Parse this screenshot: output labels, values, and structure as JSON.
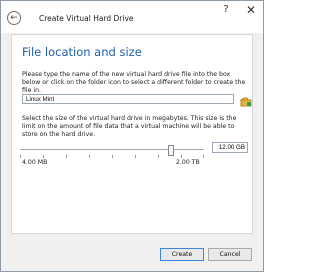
{
  "window": {
    "title": "Create Virtual Hard Drive",
    "help_label": "?",
    "close_label": "✕",
    "back_label": "←"
  },
  "section": {
    "heading": "File location and size",
    "description_location": "Please type the name of the new virtual hard drive file into the box below or click on the folder icon to select a different folder to create the file in.",
    "file_name": "Linux Mint",
    "description_size": "Select the size of the virtual hard drive in megabytes. This size is the limit on the amount of file data that a virtual machine will be able to store on the hard drive.",
    "size_value": "12.00 GB",
    "min_label": "4.00 MB",
    "max_label": "2.00 TB",
    "slider_level_fraction": 0.8
  },
  "buttons": {
    "create": "Create",
    "cancel": "Cancel"
  },
  "icons": {
    "folder": "folder-open-icon"
  }
}
